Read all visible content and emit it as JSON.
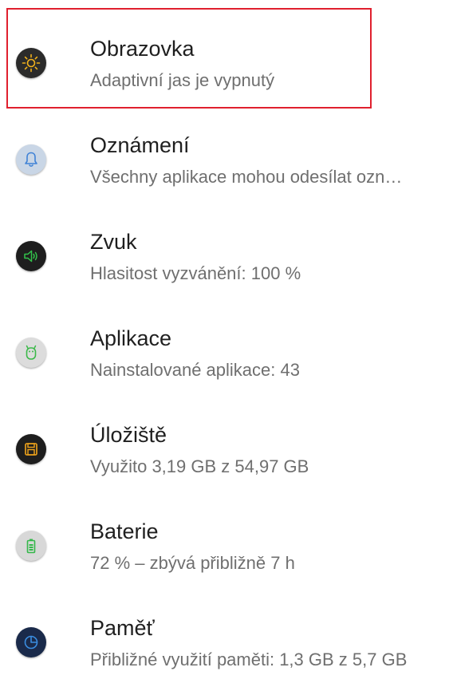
{
  "settings": {
    "items": [
      {
        "title": "Obrazovka",
        "subtitle": "Adaptivní jas je vypnutý",
        "icon": "display-brightness-icon",
        "icon_bg": "#2b2b2b",
        "icon_fg": "#f2b21b"
      },
      {
        "title": "Oznámení",
        "subtitle": "Všechny aplikace mohou odesílat ozn…",
        "icon": "notification-bell-icon",
        "icon_bg": "#c9d6e6",
        "icon_fg": "#3f82d6"
      },
      {
        "title": "Zvuk",
        "subtitle": "Hlasitost vyzvánění: 100 %",
        "icon": "sound-speaker-icon",
        "icon_bg": "#1e1e1e",
        "icon_fg": "#32c24a"
      },
      {
        "title": "Aplikace",
        "subtitle": "Nainstalované aplikace: 43",
        "icon": "apps-android-icon",
        "icon_bg": "#dcdcdc",
        "icon_fg": "#3cb94a"
      },
      {
        "title": "Úložiště",
        "subtitle": "Využito 3,19 GB z 54,97 GB",
        "icon": "storage-floppy-icon",
        "icon_bg": "#1e1e1e",
        "icon_fg": "#f2a51b"
      },
      {
        "title": "Baterie",
        "subtitle": "72 % – zbývá přibližně 7 h",
        "icon": "battery-icon",
        "icon_bg": "#d8d8d8",
        "icon_fg": "#34b84a"
      },
      {
        "title": "Paměť",
        "subtitle": "Přibližné využití paměti: 1,3 GB z 5,7 GB",
        "icon": "memory-pie-icon",
        "icon_bg": "#1a2a4a",
        "icon_fg": "#3a8de0"
      }
    ],
    "highlight_color": "#e0202e"
  }
}
